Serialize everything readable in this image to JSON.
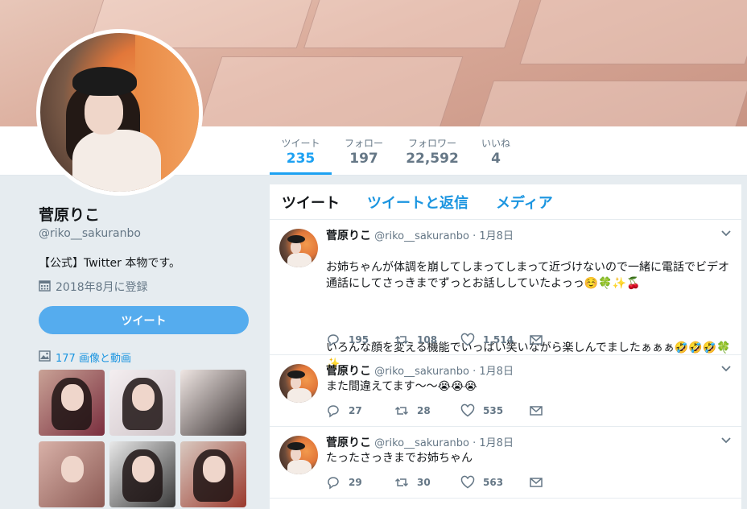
{
  "profile": {
    "name": "菅原りこ",
    "handle": "@riko__sakuranbo",
    "bio": "【公式】Twitter 本物です。",
    "joined": "2018年8月に登録",
    "tweet_button": "ツイート",
    "media_link": "177 画像と動画"
  },
  "stats": [
    {
      "label": "ツイート",
      "value": "235"
    },
    {
      "label": "フォロー",
      "value": "197"
    },
    {
      "label": "フォロワー",
      "value": "22,592"
    },
    {
      "label": "いいね",
      "value": "4"
    }
  ],
  "timeline_tabs": [
    "ツイート",
    "ツイートと返信",
    "メディア"
  ],
  "tweets": [
    {
      "name": "菅原りこ",
      "handle": "@riko__sakuranbo",
      "dot": "·",
      "date": "1月8日",
      "line1": "お姉ちゃんが体調を崩してしまってしまって近づけないので一緒に電話でビデオ通話にしてさっきまでずっとお話ししていたよっっ☺️🍀✨🍒",
      "line2": "いろんな顔を変える機能でいっぱい笑いながら楽しんでましたぁぁぁ🤣🤣🤣🍀✨",
      "replies": "195",
      "retweets": "108",
      "likes": "1,514"
    },
    {
      "name": "菅原りこ",
      "handle": "@riko__sakuranbo",
      "dot": "·",
      "date": "1月8日",
      "line1": "また間違えてます〜〜😭😭😭",
      "replies": "27",
      "retweets": "28",
      "likes": "535"
    },
    {
      "name": "菅原りこ",
      "handle": "@riko__sakuranbo",
      "dot": "·",
      "date": "1月8日",
      "line1": "たったさっきまでお姉ちゃん",
      "replies": "29",
      "retweets": "30",
      "likes": "563"
    }
  ],
  "icons": {
    "calendar": "calendar-icon",
    "media": "image-icon",
    "reply": "reply-icon",
    "retweet": "retweet-icon",
    "like": "heart-icon",
    "dm": "envelope-icon",
    "caret": "chevron-down-icon"
  },
  "colors": {
    "accent": "#1da1f2",
    "link": "#1b95e0",
    "button": "#55acee",
    "background": "#e6ecf0"
  }
}
